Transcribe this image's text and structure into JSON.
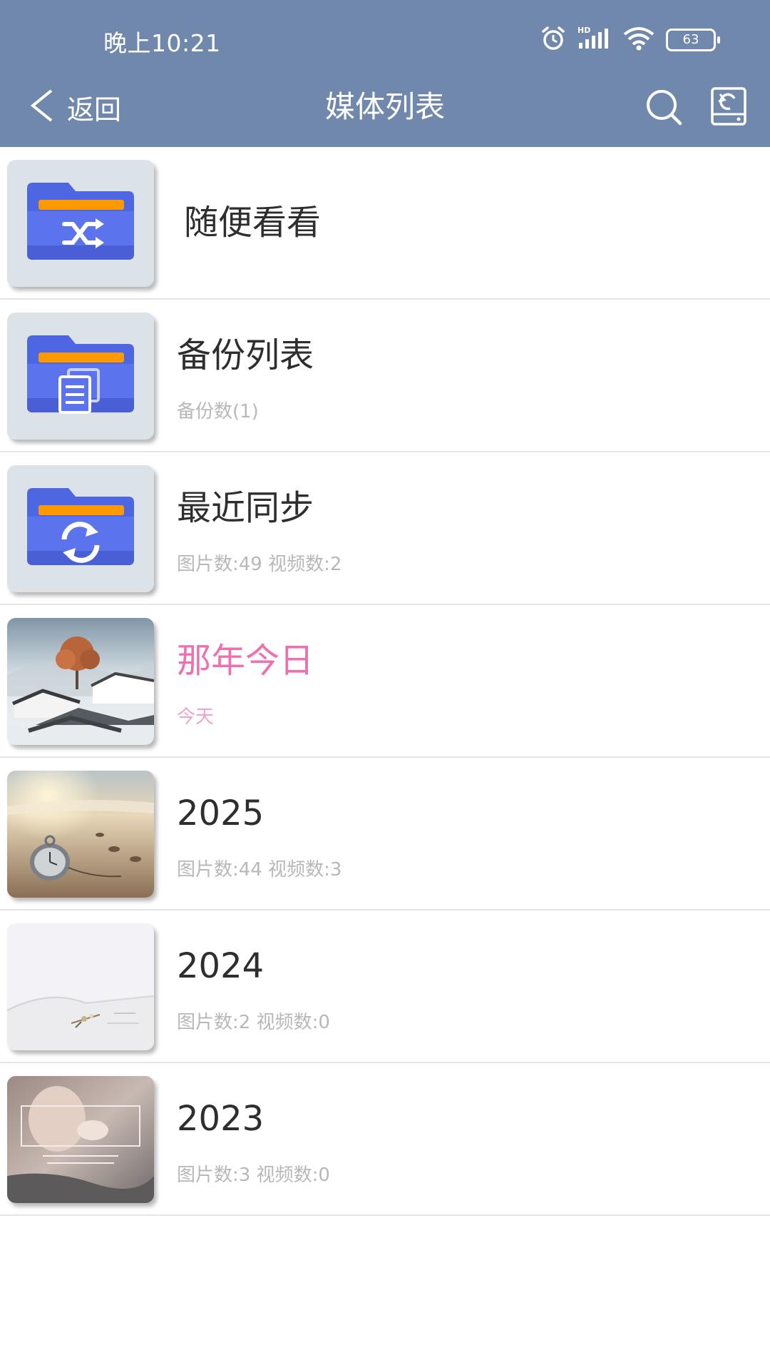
{
  "status_bar": {
    "time": "晚上10:21",
    "battery": "63",
    "icons": [
      "alarm-icon",
      "hd-signal-icon",
      "wifi-icon",
      "battery-icon"
    ]
  },
  "nav": {
    "back_label": "返回",
    "title": "媒体列表",
    "actions": [
      "search-icon",
      "restore-icon"
    ]
  },
  "colors": {
    "header_bg": "#7088ab",
    "folder_tile_bg": "#dbe2e8",
    "folder_blue": "#5068e6",
    "folder_orange": "#ff9900",
    "accent_pink": "#ef6fb1"
  },
  "items": [
    {
      "title": "随便看看",
      "subtitle": "",
      "thumb": "shuffle-folder-icon"
    },
    {
      "title": "备份列表",
      "subtitle": "备份数(1)",
      "thumb": "copy-folder-icon"
    },
    {
      "title": "最近同步",
      "subtitle": "图片数:49 视频数:2",
      "thumb": "sync-folder-icon"
    },
    {
      "title": "那年今日",
      "subtitle": "今天",
      "thumb": "misty-village-photo"
    },
    {
      "title": "2025",
      "subtitle": "图片数:44 视频数:3",
      "thumb": "beach-pocket-watch-photo"
    },
    {
      "title": "2024",
      "subtitle": "图片数:2 视频数:0",
      "thumb": "open-book-photo"
    },
    {
      "title": "2023",
      "subtitle": "图片数:3 视频数:0",
      "thumb": "portrait-card-photo"
    }
  ]
}
